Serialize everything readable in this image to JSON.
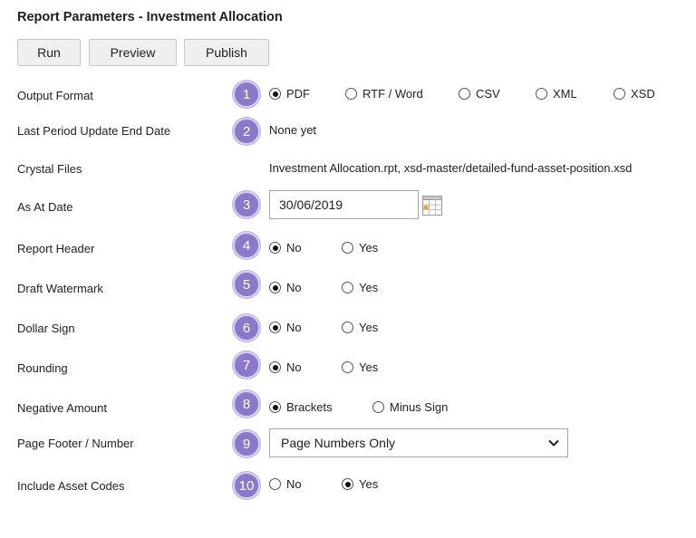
{
  "title": "Report Parameters - Investment Allocation",
  "toolbar": {
    "run_label": "Run",
    "preview_label": "Preview",
    "publish_label": "Publish"
  },
  "fields": {
    "output_format": {
      "label": "Output Format",
      "badge": "1",
      "options": [
        "PDF",
        "RTF / Word",
        "CSV",
        "XML",
        "XSD"
      ],
      "selected": "PDF"
    },
    "last_period": {
      "label": "Last Period Update End Date",
      "badge": "2",
      "value": "None yet"
    },
    "crystal_files": {
      "label": "Crystal Files",
      "value": "Investment Allocation.rpt, xsd-master/detailed-fund-asset-position.xsd"
    },
    "as_at_date": {
      "label": "As At Date",
      "badge": "3",
      "value": "30/06/2019"
    },
    "report_header": {
      "label": "Report Header",
      "badge": "4",
      "options": [
        "No",
        "Yes"
      ],
      "selected": "No"
    },
    "draft_watermark": {
      "label": "Draft Watermark",
      "badge": "5",
      "options": [
        "No",
        "Yes"
      ],
      "selected": "No"
    },
    "dollar_sign": {
      "label": "Dollar Sign",
      "badge": "6",
      "options": [
        "No",
        "Yes"
      ],
      "selected": "No"
    },
    "rounding": {
      "label": "Rounding",
      "badge": "7",
      "options": [
        "No",
        "Yes"
      ],
      "selected": "No"
    },
    "negative_amount": {
      "label": "Negative Amount",
      "badge": "8",
      "options": [
        "Brackets",
        "Minus Sign"
      ],
      "selected": "Brackets"
    },
    "page_footer": {
      "label": "Page Footer / Number",
      "badge": "9",
      "value": "Page Numbers Only"
    },
    "include_asset_codes": {
      "label": "Include Asset Codes",
      "badge": "10",
      "options": [
        "No",
        "Yes"
      ],
      "selected": "Yes"
    }
  },
  "colors": {
    "badge": "#8a78c9",
    "button_bg": "#efefef"
  },
  "icons": {
    "calendar": "calendar-icon",
    "dropdown": "chevron-down-icon"
  }
}
